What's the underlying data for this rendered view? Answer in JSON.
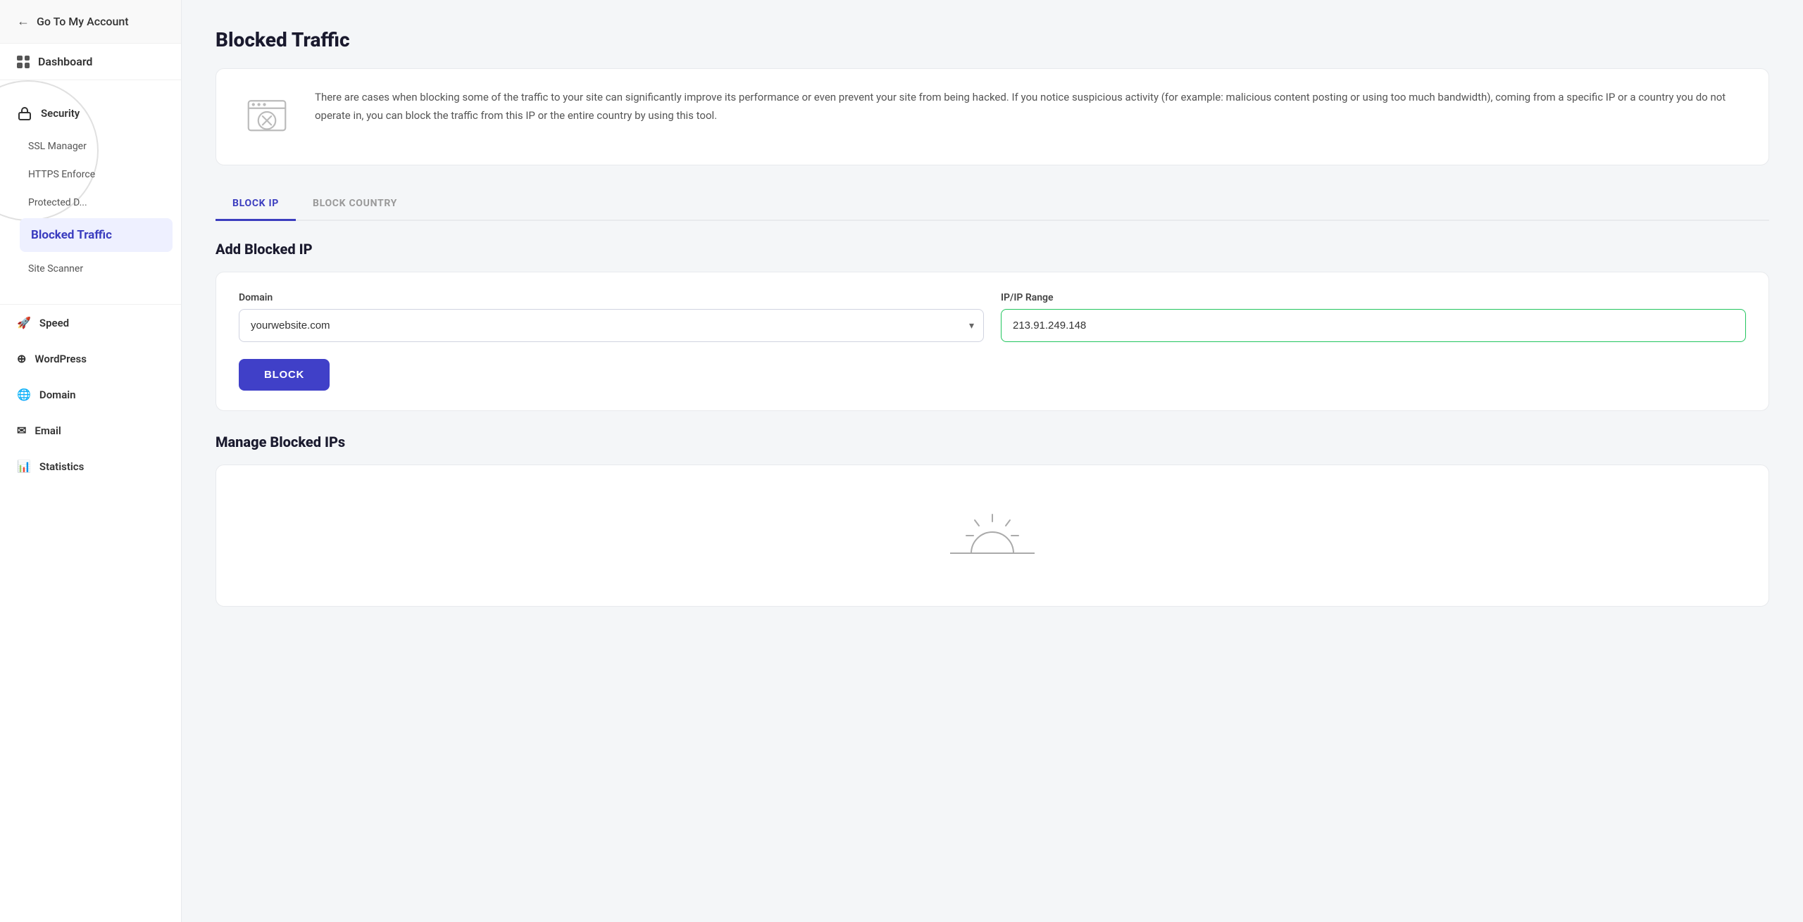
{
  "sidebar": {
    "back_label": "Go To My Account",
    "dashboard_label": "Dashboard",
    "security_label": "Security",
    "sub_items": [
      {
        "label": "SSL Manager"
      },
      {
        "label": "HTTPS Enforce"
      },
      {
        "label": "Protected D..."
      }
    ],
    "active_item": "Blocked Traffic",
    "extra_item": "Site Scanner",
    "bottom_items": [
      {
        "label": "Speed",
        "icon": "speed-icon"
      },
      {
        "label": "WordPress",
        "icon": "wordpress-icon"
      },
      {
        "label": "Domain",
        "icon": "domain-icon"
      },
      {
        "label": "Email",
        "icon": "email-icon"
      },
      {
        "label": "Statistics",
        "icon": "statistics-icon"
      }
    ]
  },
  "main": {
    "page_title": "Blocked Traffic",
    "info_text": "There are cases when blocking some of the traffic to your site can significantly improve its performance or even prevent your site from being hacked. If you notice suspicious activity (for example: malicious content posting or using too much bandwidth), coming from a specific IP or a country you do not operate in, you can block the traffic from this IP or the entire country by using this tool.",
    "tabs": [
      {
        "label": "BLOCK IP",
        "active": true
      },
      {
        "label": "BLOCK COUNTRY",
        "active": false
      }
    ],
    "add_blocked_ip": {
      "title": "Add Blocked IP",
      "domain_label": "Domain",
      "domain_value": "yourwebsite.com",
      "ip_label": "IP/IP Range",
      "ip_value": "213.91.249.148",
      "block_btn_label": "BLOCK"
    },
    "manage_blocked_ips": {
      "title": "Manage Blocked IPs"
    }
  }
}
